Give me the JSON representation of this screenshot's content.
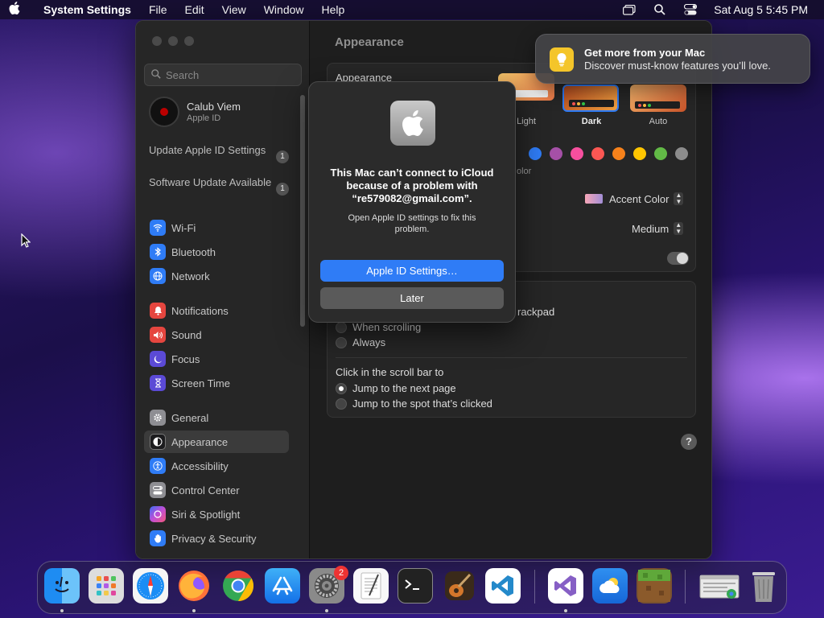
{
  "menubar": {
    "app_name": "System Settings",
    "menus": [
      "File",
      "Edit",
      "View",
      "Window",
      "Help"
    ],
    "clock": "Sat Aug 5  5:45 PM"
  },
  "sidebar": {
    "search_placeholder": "Search",
    "user_name": "Calub Viem",
    "user_sub": "Apple ID",
    "notices": [
      {
        "label": "Update Apple ID Settings",
        "badge": "1"
      },
      {
        "label": "Software Update Available",
        "badge": "1"
      }
    ],
    "items": [
      {
        "label": "Wi-Fi",
        "icon": "wifi-icon",
        "color": "#2f7cf6"
      },
      {
        "label": "Bluetooth",
        "icon": "bluetooth-icon",
        "color": "#2f7cf6"
      },
      {
        "label": "Network",
        "icon": "globe-icon",
        "color": "#2f7cf6"
      },
      {
        "label": "Notifications",
        "icon": "bell-icon",
        "color": "#e5463f"
      },
      {
        "label": "Sound",
        "icon": "speaker-icon",
        "color": "#e5463f"
      },
      {
        "label": "Focus",
        "icon": "moon-icon",
        "color": "#5b4ad6"
      },
      {
        "label": "Screen Time",
        "icon": "hourglass-icon",
        "color": "#5b4ad6"
      },
      {
        "label": "General",
        "icon": "gear-icon",
        "color": "#8e8e93"
      },
      {
        "label": "Appearance",
        "icon": "appearance-icon",
        "color": "#1c1c1e"
      },
      {
        "label": "Accessibility",
        "icon": "accessibility-icon",
        "color": "#2f7cf6"
      },
      {
        "label": "Control Center",
        "icon": "control-center-icon",
        "color": "#8e8e93"
      },
      {
        "label": "Siri & Spotlight",
        "icon": "siri-icon",
        "color": "#c04fd6"
      },
      {
        "label": "Privacy & Security",
        "icon": "hand-icon",
        "color": "#2f7cf6"
      }
    ]
  },
  "content": {
    "title": "Appearance",
    "appearance_label": "Appearance",
    "modes": [
      "Light",
      "Dark",
      "Auto"
    ],
    "accent_swatches": [
      "#2f7cf6",
      "#a550a7",
      "#f74f9e",
      "#fc5753",
      "#f7821b",
      "#ffc600",
      "#62ba46",
      "#8c8c8c"
    ],
    "accent_caption": "olor",
    "highlight_value": "Accent Color",
    "sidebar_icon_value": "Medium",
    "scroll_show_label": "rackpad",
    "scroll_options": [
      "When scrolling",
      "Always"
    ],
    "click_label": "Click in the scroll bar to",
    "click_options": [
      "Jump to the next page",
      "Jump to the spot that’s clicked"
    ],
    "help": "?"
  },
  "dialog": {
    "title": "This Mac can’t connect to iCloud because of a problem with “re579082@gmail.com”.",
    "body": "Open Apple ID settings to fix this problem.",
    "primary": "Apple ID Settings…",
    "secondary": "Later"
  },
  "notification": {
    "title": "Get more from your Mac",
    "body": "Discover must-know features you’ll love."
  },
  "dock": {
    "settings_badge": "2"
  }
}
